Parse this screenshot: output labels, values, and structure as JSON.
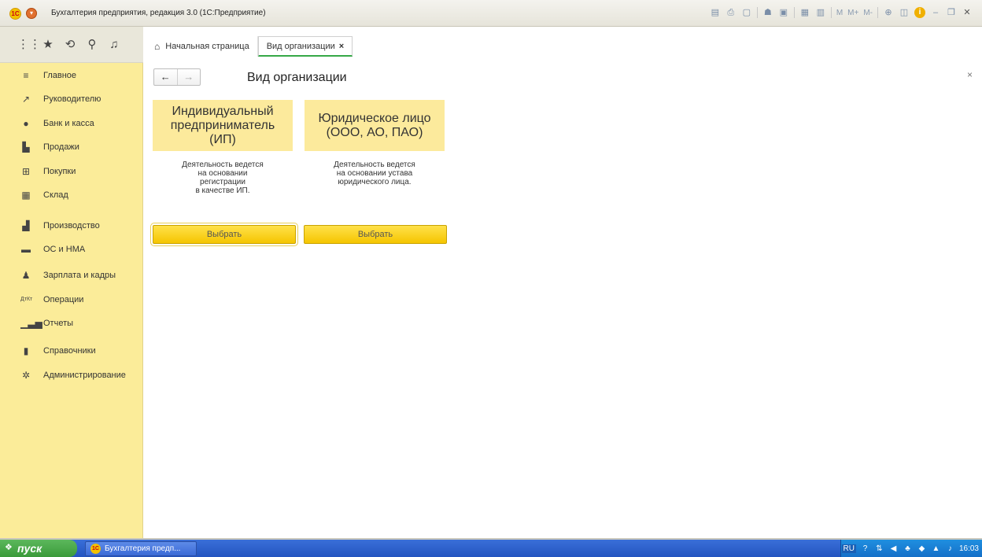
{
  "window": {
    "title": "Бухгалтерия предприятия, редакция 3.0  (1С:Предприятие)",
    "app_logo_text": "1С",
    "toolbar_icons": [
      "save-icon",
      "print-icon",
      "preview-icon",
      "users-icon",
      "copy-icon",
      "calc-icon",
      "calendar-icon"
    ],
    "memory_labels": [
      "M",
      "M+",
      "M-"
    ],
    "controls": [
      "minimize-icon",
      "restore-icon",
      "close-icon"
    ]
  },
  "toolbar": {
    "icons": [
      "apps-grid-icon",
      "star-icon",
      "history-icon",
      "search-icon",
      "bell-icon"
    ]
  },
  "tabs": [
    {
      "label": "Начальная страница",
      "icon": "home-icon",
      "active": false
    },
    {
      "label": "Вид организации",
      "active": true,
      "close": "×"
    }
  ],
  "sidebar": {
    "items": [
      {
        "label": "Главное",
        "icon": "menu-lines-icon"
      },
      {
        "label": "Руководителю",
        "icon": "trend-icon"
      },
      {
        "label": "Банк и касса",
        "icon": "coin-icon"
      },
      {
        "label": "Продажи",
        "icon": "bag-icon"
      },
      {
        "label": "Покупки",
        "icon": "cart-icon"
      },
      {
        "label": "Склад",
        "icon": "warehouse-icon"
      },
      {
        "label": "Производство",
        "icon": "factory-icon"
      },
      {
        "label": "ОС и НМА",
        "icon": "truck-icon"
      },
      {
        "label": "Зарплата и кадры",
        "icon": "person-icon"
      },
      {
        "label": "Операции",
        "icon": "dt-kt-icon"
      },
      {
        "label": "Отчеты",
        "icon": "bar-chart-icon"
      },
      {
        "label": "Справочники",
        "icon": "book-icon"
      },
      {
        "label": "Администрирование",
        "icon": "gear-icon"
      }
    ]
  },
  "form": {
    "title": "Вид организации",
    "back": "←",
    "forward": "→",
    "close": "×",
    "options": [
      {
        "heading": "Индивидуальный предприниматель (ИП)",
        "description": "Деятельность ведется\nна основании\nрегистрации\nв качестве ИП.",
        "button": "Выбрать"
      },
      {
        "heading": "Юридическое лицо (ООО, АО, ПАО)",
        "description": "Деятельность ведется\nна основании устава\nюридического лица.",
        "button": "Выбрать"
      }
    ]
  },
  "taskbar": {
    "start_label": "пуск",
    "task_label": "Бухгалтерия предп...",
    "lang": "RU",
    "clock": "16:03"
  },
  "colors": {
    "sidebar_bg": "#fbec99",
    "card_head_bg": "#fcea9c",
    "button_yellow": "#ffd41a",
    "active_tab_underline": "#36a847",
    "taskbar_blue": "#2f5fcf"
  }
}
